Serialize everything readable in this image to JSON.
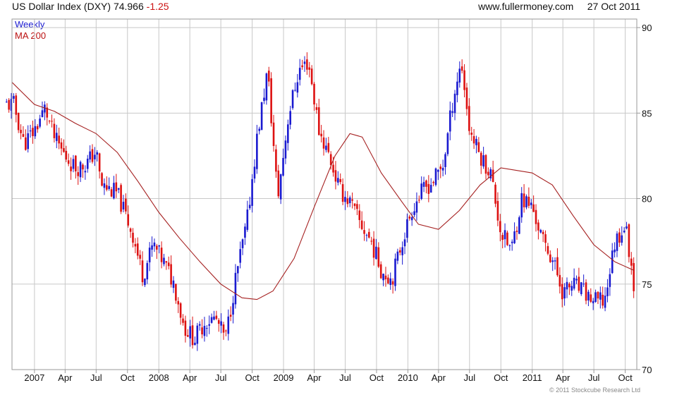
{
  "header": {
    "title": "US Dollar Index (DXY)",
    "last_value": "74.966",
    "change": "-1.25",
    "website": "www.fullermoney.com",
    "date": "27 Oct 2011"
  },
  "footer": {
    "copyright": "© 2011 Stockcube Research Ltd"
  },
  "colors": {
    "up_bar": "#1a1ad0",
    "down_bar": "#dd1111",
    "ma": "#a52020",
    "grid": "#c8c8c8"
  },
  "chart_data": {
    "type": "line",
    "title": "US Dollar Index (DXY)",
    "subtitle": "74.966 -1.25",
    "xlabel": "",
    "ylabel": "",
    "y_axis_position": "right",
    "ylim": [
      70,
      90.5
    ],
    "y_ticks": [
      70,
      75,
      80,
      85,
      90
    ],
    "grid": true,
    "legend": {
      "position": "top-left",
      "entries": [
        "Weekly",
        "MA 200"
      ]
    },
    "x_range": [
      "2006-10-27",
      "2011-11-04"
    ],
    "x_ticks": [
      {
        "date": "2007-01-01",
        "label": "2007"
      },
      {
        "date": "2007-04-01",
        "label": "Apr"
      },
      {
        "date": "2007-07-01",
        "label": "Jul"
      },
      {
        "date": "2007-10-01",
        "label": "Oct"
      },
      {
        "date": "2008-01-01",
        "label": "2008"
      },
      {
        "date": "2008-04-01",
        "label": "Apr"
      },
      {
        "date": "2008-07-01",
        "label": "Jul"
      },
      {
        "date": "2008-10-01",
        "label": "Oct"
      },
      {
        "date": "2009-01-01",
        "label": "2009"
      },
      {
        "date": "2009-04-01",
        "label": "Apr"
      },
      {
        "date": "2009-07-01",
        "label": "Jul"
      },
      {
        "date": "2009-10-01",
        "label": "Oct"
      },
      {
        "date": "2010-01-01",
        "label": "2010"
      },
      {
        "date": "2010-04-01",
        "label": "Apr"
      },
      {
        "date": "2010-07-01",
        "label": "Jul"
      },
      {
        "date": "2010-10-01",
        "label": "Oct"
      },
      {
        "date": "2011-01-01",
        "label": "2011"
      },
      {
        "date": "2011-04-01",
        "label": "Apr"
      },
      {
        "date": "2011-07-01",
        "label": "Jul"
      },
      {
        "date": "2011-10-01",
        "label": "Oct"
      }
    ],
    "series": [
      {
        "name": "Weekly",
        "kind": "price_bars",
        "points": [
          [
            "2006-11-01",
            85.5
          ],
          [
            "2006-12-01",
            83.2
          ],
          [
            "2007-01-01",
            84.0
          ],
          [
            "2007-02-01",
            85.3
          ],
          [
            "2007-03-01",
            83.5
          ],
          [
            "2007-04-01",
            82.5
          ],
          [
            "2007-05-01",
            81.8
          ],
          [
            "2007-06-01",
            82.0
          ],
          [
            "2007-07-01",
            82.8
          ],
          [
            "2007-07-15",
            80.8
          ],
          [
            "2007-09-01",
            80.3
          ],
          [
            "2007-10-15",
            78.0
          ],
          [
            "2007-11-15",
            75.5
          ],
          [
            "2007-12-15",
            77.3
          ],
          [
            "2008-01-15",
            76.3
          ],
          [
            "2008-02-15",
            75.0
          ],
          [
            "2008-03-15",
            72.5
          ],
          [
            "2008-04-15",
            71.8
          ],
          [
            "2008-05-15",
            72.8
          ],
          [
            "2008-06-15",
            73.0
          ],
          [
            "2008-07-15",
            71.8
          ],
          [
            "2008-08-15",
            75.5
          ],
          [
            "2008-09-15",
            78.5
          ],
          [
            "2008-10-15",
            83.5
          ],
          [
            "2008-11-15",
            87.5
          ],
          [
            "2008-12-15",
            80.0
          ],
          [
            "2009-01-15",
            84.8
          ],
          [
            "2009-02-15",
            87.5
          ],
          [
            "2009-03-15",
            88.0
          ],
          [
            "2009-04-15",
            84.0
          ],
          [
            "2009-05-15",
            82.5
          ],
          [
            "2009-06-15",
            80.5
          ],
          [
            "2009-07-15",
            79.8
          ],
          [
            "2009-08-15",
            78.5
          ],
          [
            "2009-09-15",
            77.5
          ],
          [
            "2009-10-15",
            75.8
          ],
          [
            "2009-11-15",
            75.3
          ],
          [
            "2009-12-15",
            77.5
          ],
          [
            "2010-01-15",
            79.5
          ],
          [
            "2010-02-15",
            80.5
          ],
          [
            "2010-03-15",
            81.0
          ],
          [
            "2010-04-15",
            82.0
          ],
          [
            "2010-05-15",
            86.0
          ],
          [
            "2010-06-07",
            88.0
          ],
          [
            "2010-07-01",
            84.0
          ],
          [
            "2010-08-01",
            82.5
          ],
          [
            "2010-09-01",
            81.5
          ],
          [
            "2010-10-01",
            78.0
          ],
          [
            "2010-11-01",
            77.0
          ],
          [
            "2010-12-01",
            80.0
          ],
          [
            "2011-01-01",
            79.5
          ],
          [
            "2011-02-01",
            77.5
          ],
          [
            "2011-03-01",
            76.5
          ],
          [
            "2011-04-01",
            74.5
          ],
          [
            "2011-05-01",
            75.0
          ],
          [
            "2011-06-01",
            74.5
          ],
          [
            "2011-07-01",
            74.0
          ],
          [
            "2011-08-01",
            74.0
          ],
          [
            "2011-09-01",
            77.5
          ],
          [
            "2011-10-01",
            78.5
          ],
          [
            "2011-10-27",
            75.0
          ]
        ]
      },
      {
        "name": "MA 200",
        "kind": "line",
        "points": [
          [
            "2006-10-27",
            86.8
          ],
          [
            "2007-01-01",
            85.5
          ],
          [
            "2007-03-01",
            85.1
          ],
          [
            "2007-05-01",
            84.4
          ],
          [
            "2007-07-01",
            83.8
          ],
          [
            "2007-09-01",
            82.7
          ],
          [
            "2007-11-01",
            81.0
          ],
          [
            "2008-01-01",
            79.2
          ],
          [
            "2008-03-01",
            77.7
          ],
          [
            "2008-05-01",
            76.3
          ],
          [
            "2008-07-01",
            75.0
          ],
          [
            "2008-09-01",
            74.2
          ],
          [
            "2008-10-15",
            74.1
          ],
          [
            "2008-12-01",
            74.6
          ],
          [
            "2009-02-01",
            76.5
          ],
          [
            "2009-04-01",
            79.5
          ],
          [
            "2009-06-01",
            82.5
          ],
          [
            "2009-07-15",
            83.8
          ],
          [
            "2009-08-20",
            83.6
          ],
          [
            "2009-10-15",
            81.5
          ],
          [
            "2009-12-15",
            79.8
          ],
          [
            "2010-02-01",
            78.5
          ],
          [
            "2010-04-01",
            78.2
          ],
          [
            "2010-06-01",
            79.3
          ],
          [
            "2010-08-01",
            80.8
          ],
          [
            "2010-10-01",
            81.8
          ],
          [
            "2011-01-01",
            81.5
          ],
          [
            "2011-03-01",
            80.8
          ],
          [
            "2011-05-01",
            79.0
          ],
          [
            "2011-07-01",
            77.3
          ],
          [
            "2011-09-01",
            76.3
          ],
          [
            "2011-10-27",
            75.8
          ]
        ]
      }
    ]
  }
}
